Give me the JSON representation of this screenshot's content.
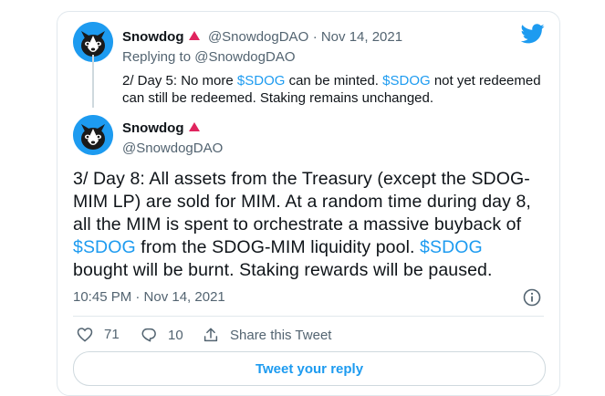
{
  "reply_tweet": {
    "author_name": "Snowdog",
    "author_handle": "@SnowdogDAO",
    "date": "· Nov 14, 2021",
    "replying_to_label": "Replying to",
    "replying_to_handle": "@SnowdogDAO",
    "text": {
      "p1": "2/ Day 5: No more ",
      "l1": "$SDOG",
      "p2": " can be minted. ",
      "l2": "$SDOG",
      "p3": " not yet redeemed",
      "p4": "can still be redeemed. Staking remains unchanged."
    }
  },
  "main_tweet": {
    "author_name": "Snowdog",
    "author_handle": "@SnowdogDAO",
    "text": {
      "line1": "3/ Day 8: All assets from the Treasury (except the SDOG-",
      "line2": "MIM LP) are sold for MIM. At a random time during day 8,",
      "line3": "all the MIM is spent to orchestrate a massive buyback of",
      "l1": "$SDOG",
      "p4": " from the SDOG-MIM liquidity pool. ",
      "l2": "$SDOG",
      "line5": "bought will be burnt. Staking rewards will be paused."
    },
    "timestamp": "10:45 PM · Nov 14, 2021",
    "likes": "71",
    "replies": "10",
    "share_label": "Share this Tweet"
  },
  "reply_button_label": "Tweet your reply",
  "colors": {
    "accent": "#1d9bf0",
    "badge": "#e0245e",
    "muted": "#536471"
  },
  "icons": [
    "twitter-bird-icon",
    "info-icon",
    "heart-icon",
    "reply-bubble-icon",
    "share-icon",
    "verified-triangle-icon"
  ]
}
